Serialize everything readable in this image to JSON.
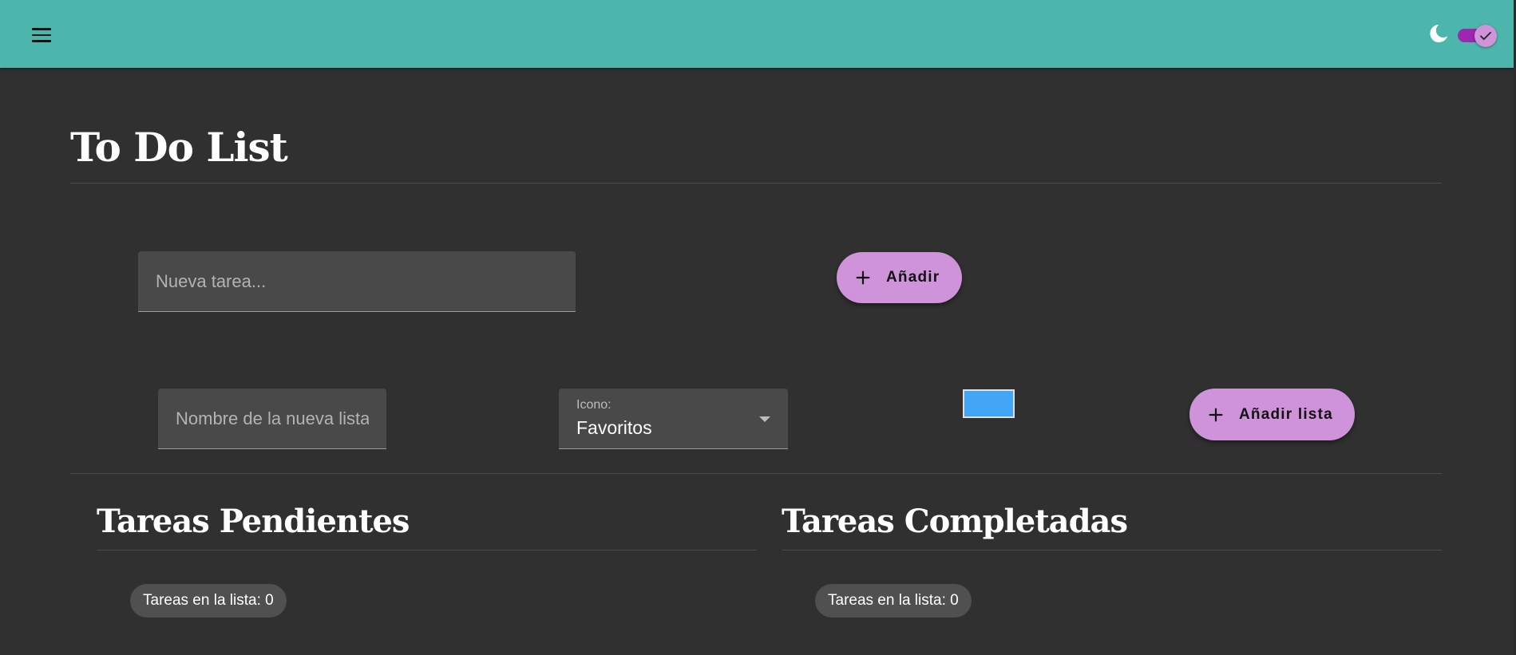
{
  "header": {
    "menu_icon": "menu-icon",
    "theme_icon": "moon-icon",
    "dark_mode_enabled": true,
    "toggle_check_icon": "check-icon",
    "colors": {
      "bar": "#4db6ac",
      "toggle_track": "#9c27b0",
      "toggle_thumb": "#ce93d8"
    }
  },
  "page": {
    "title": "To Do List",
    "background": "#303030"
  },
  "new_task": {
    "placeholder": "Nueva tarea...",
    "value": "",
    "add_label": "Añadir",
    "add_icon": "plus-icon"
  },
  "new_list": {
    "name_placeholder": "Nombre de la nueva lista:",
    "name_value": "",
    "icon_select_label": "Icono:",
    "icon_select_value": "Favoritos",
    "color_value": "#42a5f5",
    "add_label": "Añadir lista",
    "add_icon": "plus-icon"
  },
  "pending": {
    "title": "Tareas Pendientes",
    "count_text": "Tareas en la lista: 0"
  },
  "completed": {
    "title": "Tareas Completadas",
    "count_text": "Tareas en la lista: 0"
  },
  "accent": "#ce93d8"
}
